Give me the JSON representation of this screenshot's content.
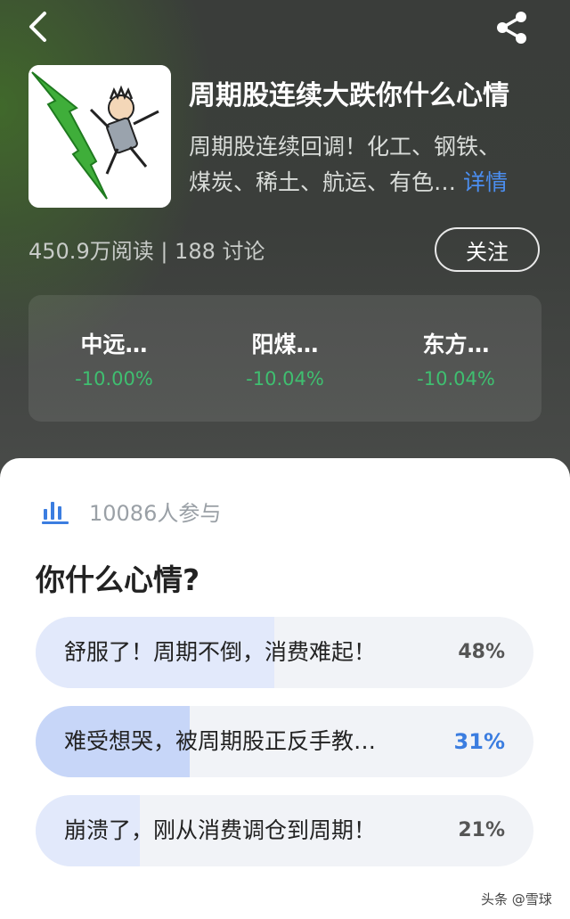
{
  "header": {
    "back_icon": "chevron-left-icon",
    "share_icon": "share-icon"
  },
  "topic": {
    "title": "周期股连续大跌你什么心情",
    "description_line1": "周期股连续回调！化工、钢铁、",
    "description_line2": "煤炭、稀土、航运、有色…",
    "detail_link": "详情",
    "stats": "450.9万阅读 | 188 讨论",
    "follow_label": "关注",
    "cover_icon": "falling-man-arrow-illustration"
  },
  "stocks": [
    {
      "name": "中远…",
      "change": "-10.00%"
    },
    {
      "name": "阳煤…",
      "change": "-10.04%"
    },
    {
      "name": "东方…",
      "change": "-10.04%"
    }
  ],
  "colors": {
    "down": "#3fbf70",
    "accent": "#3b7de0"
  },
  "poll": {
    "icon": "bar-chart-icon",
    "participants": "10086人参与",
    "question": "你什么心情?",
    "options": [
      {
        "label": "舒服了！周期不倒，消费难起！",
        "percent_text": "48%",
        "share": 0.48,
        "selected": false
      },
      {
        "label": "难受想哭，被周期股正反手教…",
        "percent_text": "31%",
        "share": 0.31,
        "selected": true
      },
      {
        "label": "崩溃了，刚从消费调仓到周期！",
        "percent_text": "21%",
        "share": 0.21,
        "selected": false
      }
    ]
  },
  "watermark": "头条 @雪球"
}
